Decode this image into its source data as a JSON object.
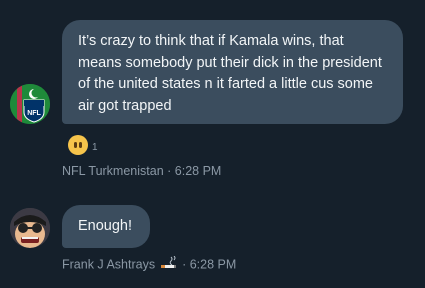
{
  "messages": [
    {
      "text": "It’s crazy to think that if Kamala wins, that means somebody put their dick in the president of the united states n it farted a little cus some air got trapped",
      "reaction": {
        "emoji": "neutral-face-emoji",
        "count": "1"
      },
      "author": "NFL Turkmenistan",
      "separator": "·",
      "time": "6:28 PM"
    },
    {
      "text": "Enough!",
      "author": "Frank J Ashtrays",
      "author_emoji": "cigarette-emoji",
      "separator": "·",
      "time": "6:28 PM"
    }
  ],
  "colors": {
    "background": "#15202b",
    "bubble": "#3b4d5e",
    "meta_text": "#8b98a5"
  }
}
